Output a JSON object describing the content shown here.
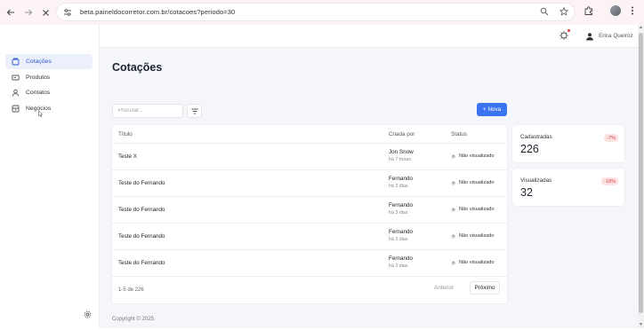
{
  "browser": {
    "url": "beta.paineldocorretor.com.br/cotacoes?periodo=30"
  },
  "sidebar": {
    "items": [
      {
        "label": "Cotações",
        "icon": "quotes-icon"
      },
      {
        "label": "Produtos",
        "icon": "products-icon"
      },
      {
        "label": "Contatos",
        "icon": "contacts-icon"
      },
      {
        "label": "Negócios",
        "icon": "deals-icon"
      }
    ]
  },
  "header": {
    "user_name": "Erica Queiroz"
  },
  "page": {
    "title": "Cotações",
    "search_placeholder": "Procurar...",
    "new_button": "Nova",
    "new_button_prefix": "+",
    "copyright": "Copyright © 2025."
  },
  "table": {
    "headers": {
      "title": "Título",
      "created_by": "Criada por",
      "status": "Status"
    },
    "rows": [
      {
        "title": "Teste X",
        "creator": "Jon Snow",
        "time": "há 7 horas",
        "status": "Não visualizado"
      },
      {
        "title": "Teste do Fernando",
        "creator": "Fernando",
        "time": "há 3 dias",
        "status": "Não visualizado"
      },
      {
        "title": "Teste do Fernando",
        "creator": "Fernando",
        "time": "há 3 dias",
        "status": "Não visualizado"
      },
      {
        "title": "Teste do Fernando",
        "creator": "Fernando",
        "time": "há 3 dias",
        "status": "Não visualizado"
      },
      {
        "title": "Teste do Fernando",
        "creator": "Fernando",
        "time": "há 3 dias",
        "status": "Não visualizado"
      }
    ],
    "pagination": {
      "count": "1-5 de 226",
      "prev": "Anterior",
      "next": "Próximo"
    }
  },
  "stats": [
    {
      "label": "Cadastradas",
      "value": "226",
      "change": "-7%"
    },
    {
      "label": "Visualizadas",
      "value": "32",
      "change": "-18%"
    }
  ],
  "colors": {
    "accent": "#3b74f0",
    "active_bg": "#ecf0fb",
    "negative_bg": "#fde2e2",
    "negative_text": "#d64545"
  }
}
